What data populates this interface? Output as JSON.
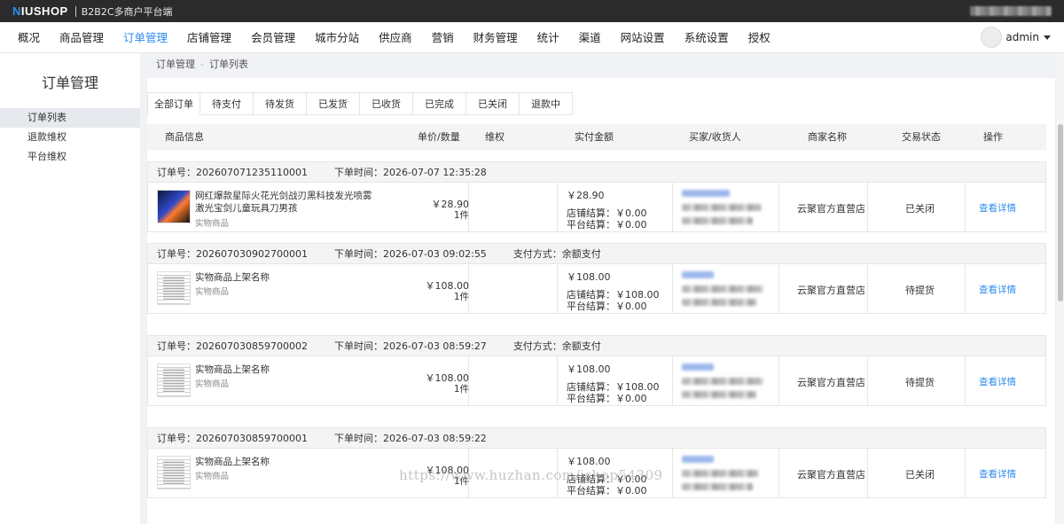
{
  "brand": {
    "logo_accent": "N",
    "logo_rest": "IUSHOP",
    "subtitle": "B2B2C多商户平台端"
  },
  "nav": {
    "items": [
      "概况",
      "商品管理",
      "订单管理",
      "店铺管理",
      "会员管理",
      "城市分站",
      "供应商",
      "营销",
      "财务管理",
      "统计",
      "渠道",
      "网站设置",
      "系统设置",
      "授权"
    ],
    "active_index": 2,
    "user": "admin"
  },
  "sidebar": {
    "title": "订单管理",
    "items": [
      "订单列表",
      "退款维权",
      "平台维权"
    ],
    "active_index": 0
  },
  "breadcrumb": {
    "parent": "订单管理",
    "separator": "-",
    "current": "订单列表"
  },
  "tabs": [
    "全部订单",
    "待支付",
    "待发货",
    "已发货",
    "已收货",
    "已完成",
    "已关闭",
    "退款中"
  ],
  "active_tab": 0,
  "table_headers": {
    "product": "商品信息",
    "price_qty": "单价/数量",
    "rights": "维权",
    "paid": "实付金额",
    "buyer": "买家/收货人",
    "merchant": "商家名称",
    "status": "交易状态",
    "op": "操作"
  },
  "orders": [
    {
      "order_no": "订单号：202607071235110001",
      "time": "下单时间：2026-07-07 12:35:28",
      "pay": "",
      "thumb": "product",
      "name": "网红爆款星际火花光剑战刃黑科技发光喷雾激光宝剑儿童玩具刀男孩",
      "type": "实物商品",
      "price": "￥28.90",
      "qty": "1件",
      "paid": "￥28.90",
      "store_settle": "店铺结算：￥0.00",
      "platform_settle": "平台结算：￥0.00",
      "merchant": "云聚官方直营店",
      "status": "已关闭",
      "op": "查看详情"
    },
    {
      "order_no": "订单号：202607030902700001",
      "time": "下单时间：2026-07-03 09:02:55",
      "pay": "支付方式：余额支付",
      "thumb": "doc",
      "name": "实物商品上架名称",
      "type": "实物商品",
      "price": "￥108.00",
      "qty": "1件",
      "paid": "￥108.00",
      "store_settle": "店铺结算：￥108.00",
      "platform_settle": "平台结算：￥0.00",
      "merchant": "云聚官方直营店",
      "status": "待提货",
      "op": "查看详情"
    },
    {
      "order_no": "订单号：202607030859700002",
      "time": "下单时间：2026-07-03 08:59:27",
      "pay": "支付方式：余额支付",
      "thumb": "doc",
      "name": "实物商品上架名称",
      "type": "实物商品",
      "price": "￥108.00",
      "qty": "1件",
      "paid": "￥108.00",
      "store_settle": "店铺结算：￥108.00",
      "platform_settle": "平台结算：￥0.00",
      "merchant": "云聚官方直营店",
      "status": "待提货",
      "op": "查看详情"
    },
    {
      "order_no": "订单号：202607030859700001",
      "time": "下单时间：2026-07-03 08:59:22",
      "pay": "",
      "thumb": "doc",
      "name": "实物商品上架名称",
      "type": "实物商品",
      "price": "￥108.00",
      "qty": "1件",
      "paid": "￥108.00",
      "store_settle": "店铺结算：￥0.00",
      "platform_settle": "平台结算：￥0.00",
      "merchant": "云聚官方直营店",
      "status": "已关闭",
      "op": "查看详情"
    }
  ],
  "watermark": "https://www.huzhan.com/ishop54309",
  "colors": {
    "accent": "#2e8cf0",
    "topbar": "#2b2b2b",
    "page_bg": "#f0f2f5"
  }
}
